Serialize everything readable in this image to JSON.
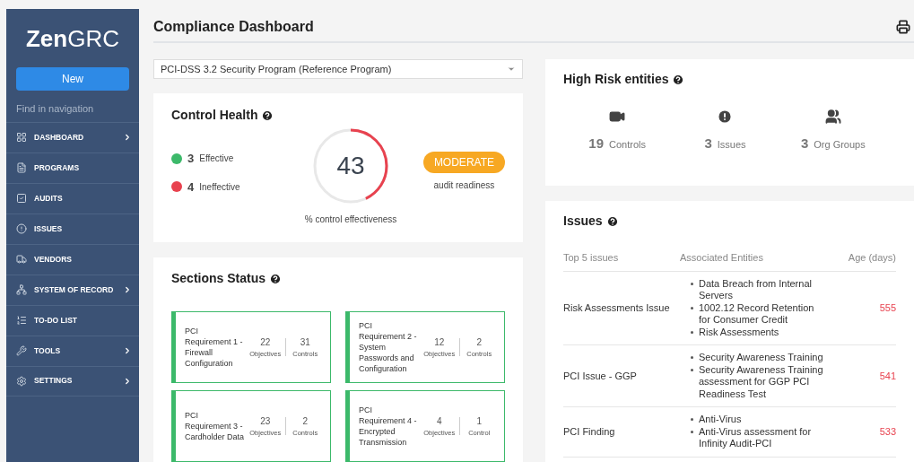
{
  "sidebar": {
    "logo": "**Zen**GRC",
    "new_button": "New",
    "search": {
      "placeholder": "Find in navigation"
    },
    "items": [
      {
        "label": "DASHBOARD",
        "submenu": true
      },
      {
        "label": "PROGRAMS",
        "submenu": false
      },
      {
        "label": "AUDITS",
        "submenu": false
      },
      {
        "label": "ISSUES",
        "submenu": false
      },
      {
        "label": "VENDORS",
        "submenu": false
      },
      {
        "label": "SYSTEM OF RECORD",
        "submenu": true
      },
      {
        "label": "TO-DO LIST",
        "submenu": false
      },
      {
        "label": "TOOLS",
        "submenu": true
      },
      {
        "label": "SETTINGS",
        "submenu": true
      }
    ]
  },
  "header": {
    "title": "Compliance Dashboard"
  },
  "program_select": {
    "value": "PCI-DSS 3.2 Security Program (Reference Program)"
  },
  "control_health": {
    "title": "Control Health",
    "legend": [
      {
        "count": "3",
        "label": "Effective",
        "color": "#3cb96a"
      },
      {
        "count": "4",
        "label": "Ineffective",
        "color": "#e8424f"
      }
    ],
    "gauge": {
      "level": 0.43,
      "reading": "43",
      "caption": "% control effectiveness"
    },
    "readiness": {
      "badge": "MODERATE",
      "caption": "audit readiness"
    }
  },
  "sections_status": {
    "title": "Sections Status",
    "sections": [
      {
        "name": "PCI Requirement 1 - Firewall Configuration",
        "objectives": "22",
        "objectives_label": "Objectives",
        "controls": "31",
        "controls_label": "Controls",
        "color": "#3cb96a"
      },
      {
        "name": "PCI Requirement 2 - System Passwords and Configuration",
        "objectives": "12",
        "objectives_label": "Objectives",
        "controls": "2",
        "controls_label": "Controls",
        "color": "#3cb96a"
      },
      {
        "name": "PCI Requirement 3 - Cardholder Data",
        "objectives": "23",
        "objectives_label": "Objectives",
        "controls": "2",
        "controls_label": "Controls",
        "color": "#3cb96a"
      },
      {
        "name": "PCI Requirement 4 - Encrypted Transmission",
        "objectives": "4",
        "objectives_label": "Objectives",
        "controls": "1",
        "controls_label": "Control",
        "color": "#3cb96a"
      }
    ]
  },
  "high_risk": {
    "title": "High Risk entities",
    "entities": [
      {
        "count": "19",
        "label": "Controls"
      },
      {
        "count": "3",
        "label": "Issues"
      },
      {
        "count": "3",
        "label": "Org Groups"
      }
    ]
  },
  "issues": {
    "title": "Issues",
    "columns": [
      "Top 5 issues",
      "Associated Entities",
      "Age (days)"
    ],
    "rows": [
      {
        "issue": "Risk Assessments Issue",
        "entities": [
          "Data Breach from Internal Servers",
          "1002.12 Record Retention for Consumer Credit",
          "Risk Assessments"
        ],
        "age": "555"
      },
      {
        "issue": "PCI Issue - GGP",
        "entities": [
          "Security Awareness Training",
          "Security Awareness Training assessment for GGP PCI Readiness Test"
        ],
        "age": "541"
      },
      {
        "issue": "PCI Finding",
        "entities": [
          "Anti-Virus",
          "Anti-Virus assessment for Infinity Audit-PCI"
        ],
        "age": "533"
      }
    ]
  }
}
